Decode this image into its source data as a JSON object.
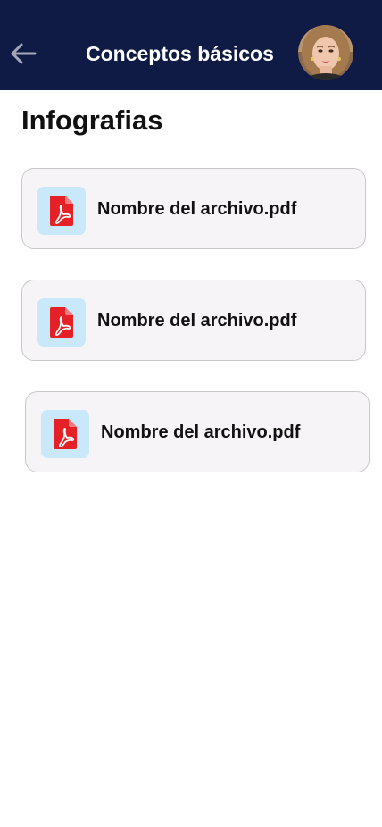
{
  "header": {
    "title": "Conceptos básicos",
    "back_icon": "arrow-left-icon",
    "avatar": "user-avatar",
    "background_color": "#0f1b45"
  },
  "section": {
    "title": "Infografias"
  },
  "files": [
    {
      "name": "Nombre del archivo.pdf",
      "icon": "pdf-file-icon"
    },
    {
      "name": "Nombre del archivo.pdf",
      "icon": "pdf-file-icon"
    },
    {
      "name": "Nombre del archivo.pdf",
      "icon": "pdf-file-icon"
    }
  ],
  "colors": {
    "header": "#0f1b45",
    "card_background": "#f6f4f6",
    "icon_background": "#c9e9fb",
    "pdf_red": "#e52127"
  }
}
